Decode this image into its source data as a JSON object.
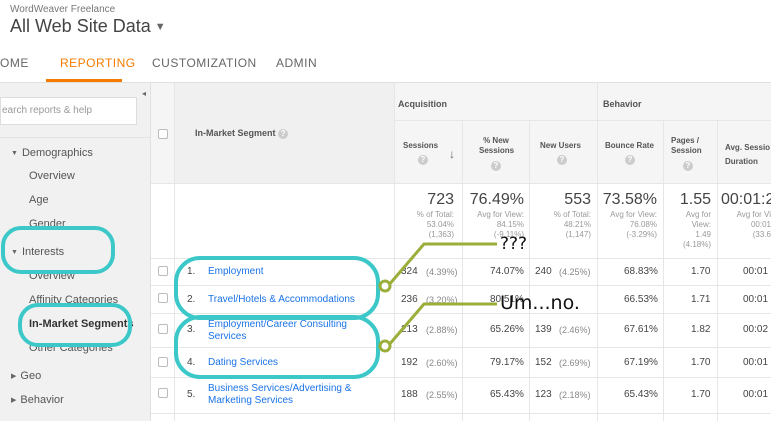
{
  "header": {
    "account": "WordWeaver Freelance",
    "property": "All Web Site Data",
    "caret": "▼"
  },
  "tabs": [
    {
      "label": "OME"
    },
    {
      "label": "REPORTING"
    },
    {
      "label": "CUSTOMIZATION"
    },
    {
      "label": "ADMIN"
    }
  ],
  "sidebar": {
    "search_placeholder": "earch reports & help",
    "collapse_glyph": "◂",
    "items": [
      {
        "label": "Demographics"
      },
      {
        "label": "Overview"
      },
      {
        "label": "Age"
      },
      {
        "label": "Gender"
      },
      {
        "label": "Interests"
      },
      {
        "label": "Overview"
      },
      {
        "label": "Affinity Categories"
      },
      {
        "label": "In-Market Segments"
      },
      {
        "label": "Other Categories"
      },
      {
        "label": "Geo"
      },
      {
        "label": "Behavior"
      }
    ]
  },
  "table": {
    "group_acquisition": "Acquisition",
    "group_behavior": "Behavior",
    "dimension_header": "In-Market Segment",
    "help_glyph": "?",
    "sort_glyph": "↓",
    "columns": [
      "Sessions",
      "% New Sessions",
      "New Users",
      "Bounce Rate",
      "Pages / Session",
      "Avg. Session Duration"
    ],
    "column_lines": [
      [
        "Sessions",
        ""
      ],
      [
        "% New",
        "Sessions"
      ],
      [
        "New Users",
        ""
      ],
      [
        "Bounce Rate",
        ""
      ],
      [
        "Pages /",
        "Session"
      ],
      [
        "Avg. Sessio",
        "Duration"
      ]
    ],
    "totals": [
      {
        "big": "723",
        "lines": [
          "% of Total:",
          "53.04%",
          "(1,363)"
        ]
      },
      {
        "big": "76.49%",
        "lines": [
          "Avg for View:",
          "84.15%",
          "(-9.11%)"
        ]
      },
      {
        "big": "553",
        "lines": [
          "% of Total:",
          "48.21%",
          "(1,147)"
        ]
      },
      {
        "big": "73.58%",
        "lines": [
          "Avg for View:",
          "76.08%",
          "(-3.29%)"
        ]
      },
      {
        "big": "1.55",
        "lines": [
          "Avg for",
          "View:",
          "1.49",
          "(4.18%)"
        ]
      },
      {
        "big": "00:01:2",
        "lines": [
          "Avg for Vi",
          "00:01",
          "(33.6"
        ]
      }
    ],
    "rows": [
      {
        "index": "1.",
        "segment": [
          "Employment",
          ""
        ],
        "sessions": "324",
        "sessions_pct": "(4.39%)",
        "new_sessions": "74.07%",
        "new_users": "240",
        "new_users_pct": "(4.25%)",
        "bounce": "68.83%",
        "pages": "1.70",
        "duration": "00:01"
      },
      {
        "index": "2.",
        "segment": [
          "Travel/Hotels & Accommodations",
          ""
        ],
        "sessions": "236",
        "sessions_pct": "(3.20%)",
        "new_sessions": "80.51%",
        "new_users": "",
        "new_users_pct": "",
        "bounce": "66.53%",
        "pages": "1.71",
        "duration": "00:01"
      },
      {
        "index": "3.",
        "segment": [
          "Employment/Career Consulting",
          "Services"
        ],
        "sessions": "213",
        "sessions_pct": "(2.88%)",
        "new_sessions": "65.26%",
        "new_users": "139",
        "new_users_pct": "(2.46%)",
        "bounce": "67.61%",
        "pages": "1.82",
        "duration": "00:02"
      },
      {
        "index": "4.",
        "segment": [
          "Dating Services",
          ""
        ],
        "sessions": "192",
        "sessions_pct": "(2.60%)",
        "new_sessions": "79.17%",
        "new_users": "152",
        "new_users_pct": "(2.69%)",
        "bounce": "67.19%",
        "pages": "1.70",
        "duration": "00:01"
      },
      {
        "index": "5.",
        "segment": [
          "Business Services/Advertising &",
          "Marketing Services"
        ],
        "sessions": "188",
        "sessions_pct": "(2.55%)",
        "new_sessions": "65.43%",
        "new_users": "123",
        "new_users_pct": "(2.18%)",
        "bounce": "65.43%",
        "pages": "1.70",
        "duration": "00:01"
      }
    ]
  },
  "annotations": {
    "note_1": "???",
    "note_2": "Um...no.",
    "highlight_color": "#3cc8c8",
    "pointer_color": "#9aae3a"
  }
}
